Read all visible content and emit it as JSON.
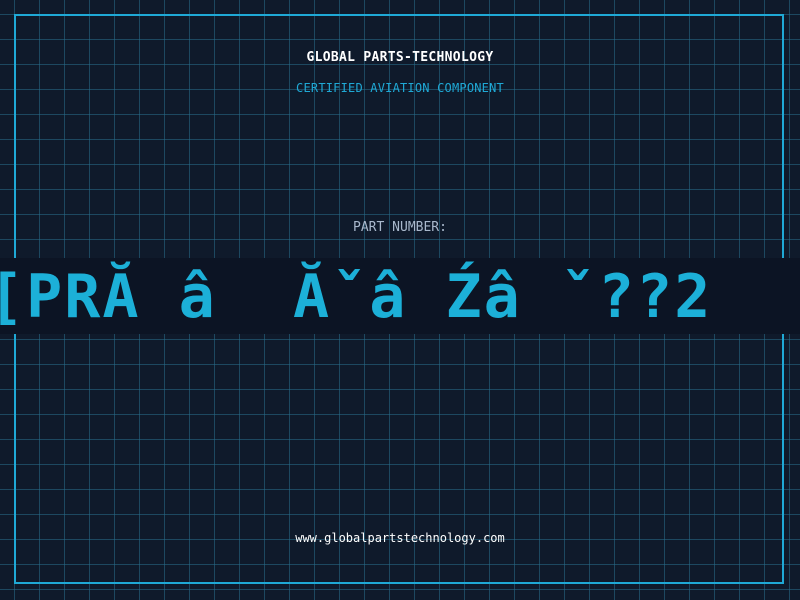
{
  "header": {
    "company": "GLOBAL PARTS-TECHNOLOGY",
    "subtitle": "CERTIFIED AVIATION COMPONENT"
  },
  "part": {
    "label": "PART NUMBER:",
    "value": "[PRĂ â  Ăˇâ Źâ ˇ??2"
  },
  "footer": {
    "url": "www.globalpartstechnology.com"
  },
  "colors": {
    "background": "#0f1a2b",
    "grid": "#286e8c",
    "accent": "#1fa9d6",
    "part_text": "#1cb0d8",
    "label": "#a9b8cc"
  }
}
